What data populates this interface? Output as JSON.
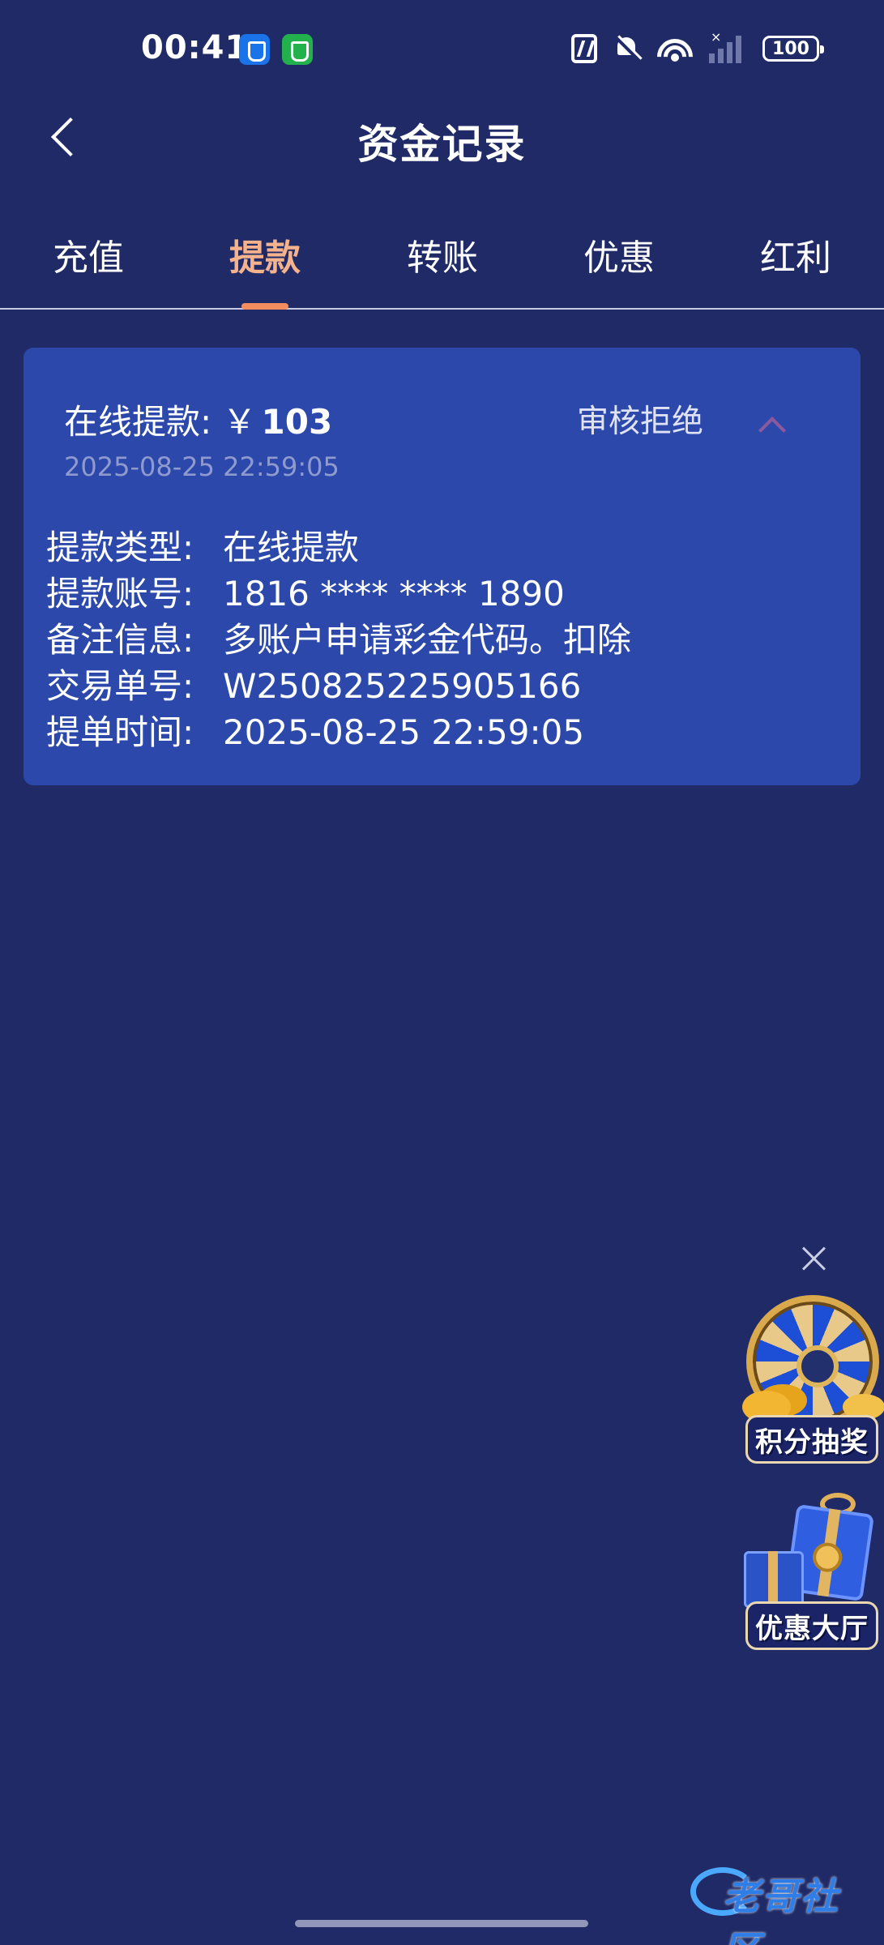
{
  "status_bar": {
    "time": "00:41",
    "battery": "100",
    "icons": [
      "vpn-shield-icon",
      "security-shield-icon",
      "nfc-icon",
      "mute-icon",
      "wifi-icon",
      "signal-icon",
      "battery-icon"
    ]
  },
  "header": {
    "title": "资金记录",
    "back_icon": "chevron-left-icon"
  },
  "tabs": [
    {
      "label": "充值",
      "active": false
    },
    {
      "label": "提款",
      "active": true
    },
    {
      "label": "转账",
      "active": false
    },
    {
      "label": "优惠",
      "active": false
    },
    {
      "label": "红利",
      "active": false
    }
  ],
  "record": {
    "title": "在线提款:",
    "currency": "￥",
    "amount": "103",
    "date": "2025-08-25 22:59:05",
    "status": "审核拒绝",
    "details": [
      {
        "label": "提款类型:",
        "value": "在线提款"
      },
      {
        "label": "提款账号:",
        "value": "1816 **** **** 1890"
      },
      {
        "label": "备注信息:",
        "value": "多账户申请彩金代码。扣除"
      },
      {
        "label": "交易单号:",
        "value": "W250825225905166"
      },
      {
        "label": "提单时间:",
        "value": "2025-08-25 22:59:05"
      }
    ]
  },
  "floating": {
    "lottery_label": "积分抽奖",
    "promo_label": "优惠大厅"
  },
  "watermark": {
    "text": "老哥社区"
  },
  "colors": {
    "background": "#1f2a66",
    "card": "#2b48aa",
    "active_tab": "#f4b28d",
    "indicator": "#f28c5f"
  }
}
